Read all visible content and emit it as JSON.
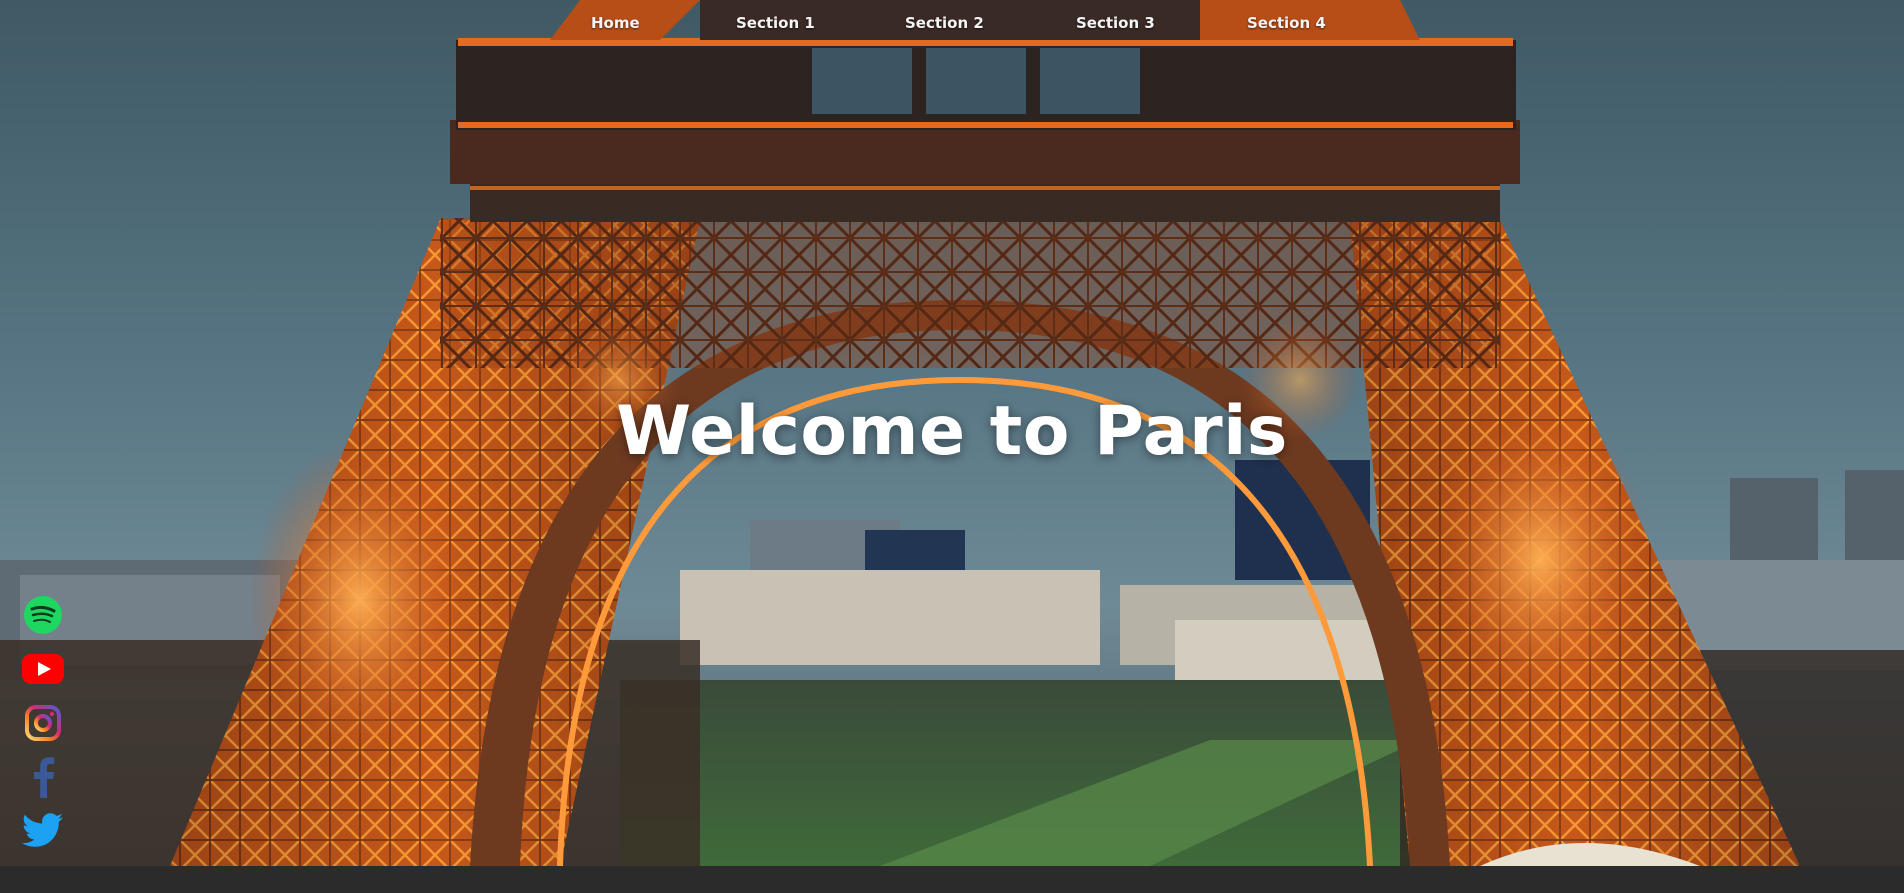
{
  "nav": {
    "items": [
      {
        "label": "Home"
      },
      {
        "label": "Section 1"
      },
      {
        "label": "Section 2"
      },
      {
        "label": "Section 3"
      },
      {
        "label": "Section 4"
      }
    ]
  },
  "hero": {
    "title": "Welcome to Paris"
  },
  "social": {
    "icons": [
      "spotify-icon",
      "youtube-icon",
      "instagram-icon",
      "facebook-icon",
      "twitter-icon"
    ]
  },
  "colors": {
    "sky": "#4f6b78",
    "tower_glow": "#ff7a1e",
    "footer": "#2b2b2b",
    "spotify": "#1ed760",
    "youtube": "#ff0000",
    "facebook": "#3b5998",
    "twitter": "#1da1f2"
  }
}
